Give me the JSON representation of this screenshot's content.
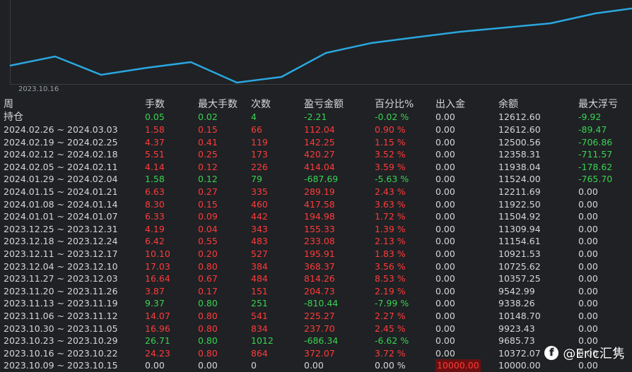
{
  "chart": {
    "date_label": "2023.10.16",
    "line_color": "#2aa7e0"
  },
  "headers": [
    "周",
    "手数",
    "最大手数",
    "次数",
    "盈亏金额",
    "百分比%",
    "出入金",
    "余额",
    "最大浮亏"
  ],
  "holding": {
    "label": "持仓",
    "lots": "0.05",
    "max_lots": "0.02",
    "count": "4",
    "pl": "-2.21",
    "pct": "-0.02 %",
    "io": "0.00",
    "balance": "12612.60",
    "max_float": "-9.92"
  },
  "rows": [
    {
      "period": "2024.02.26 ~ 2024.03.03",
      "lots": "1.58",
      "max_lots": "0.15",
      "count": "66",
      "pl": "112.04",
      "pct": "0.90 %",
      "io": "0.00",
      "balance": "12612.60",
      "max_float": "-89.47",
      "tone": "red",
      "float_tone": "green"
    },
    {
      "period": "2024.02.19 ~ 2024.02.25",
      "lots": "4.37",
      "max_lots": "0.41",
      "count": "119",
      "pl": "142.25",
      "pct": "1.15 %",
      "io": "0.00",
      "balance": "12500.56",
      "max_float": "-706.86",
      "tone": "red",
      "float_tone": "green"
    },
    {
      "period": "2024.02.12 ~ 2024.02.18",
      "lots": "5.51",
      "max_lots": "0.25",
      "count": "173",
      "pl": "420.27",
      "pct": "3.52 %",
      "io": "0.00",
      "balance": "12358.31",
      "max_float": "-711.57",
      "tone": "red",
      "float_tone": "green"
    },
    {
      "period": "2024.02.05 ~ 2024.02.11",
      "lots": "4.14",
      "max_lots": "0.12",
      "count": "226",
      "pl": "414.04",
      "pct": "3.59 %",
      "io": "0.00",
      "balance": "11938.04",
      "max_float": "-178.62",
      "tone": "red",
      "float_tone": "green"
    },
    {
      "period": "2024.01.29 ~ 2024.02.04",
      "lots": "1.58",
      "max_lots": "0.12",
      "count": "79",
      "pl": "-687.69",
      "pct": "-5.63 %",
      "io": "0.00",
      "balance": "11524.00",
      "max_float": "-765.70",
      "tone": "green",
      "float_tone": "green"
    },
    {
      "period": "2024.01.15 ~ 2024.01.21",
      "lots": "6.63",
      "max_lots": "0.27",
      "count": "335",
      "pl": "289.19",
      "pct": "2.43 %",
      "io": "0.00",
      "balance": "12211.69",
      "max_float": "0.00",
      "tone": "red",
      "float_tone": "neutral"
    },
    {
      "period": "2024.01.08 ~ 2024.01.14",
      "lots": "8.30",
      "max_lots": "0.15",
      "count": "460",
      "pl": "417.58",
      "pct": "3.63 %",
      "io": "0.00",
      "balance": "11922.50",
      "max_float": "0.00",
      "tone": "red",
      "float_tone": "neutral"
    },
    {
      "period": "2024.01.01 ~ 2024.01.07",
      "lots": "6.33",
      "max_lots": "0.09",
      "count": "442",
      "pl": "194.98",
      "pct": "1.72 %",
      "io": "0.00",
      "balance": "11504.92",
      "max_float": "0.00",
      "tone": "red",
      "float_tone": "neutral"
    },
    {
      "period": "2023.12.25 ~ 2023.12.31",
      "lots": "4.19",
      "max_lots": "0.04",
      "count": "343",
      "pl": "155.33",
      "pct": "1.39 %",
      "io": "0.00",
      "balance": "11309.94",
      "max_float": "0.00",
      "tone": "red",
      "float_tone": "neutral"
    },
    {
      "period": "2023.12.18 ~ 2023.12.24",
      "lots": "6.42",
      "max_lots": "0.55",
      "count": "483",
      "pl": "233.08",
      "pct": "2.13 %",
      "io": "0.00",
      "balance": "11154.61",
      "max_float": "0.00",
      "tone": "red",
      "float_tone": "neutral"
    },
    {
      "period": "2023.12.11 ~ 2023.12.17",
      "lots": "10.10",
      "max_lots": "0.20",
      "count": "527",
      "pl": "195.91",
      "pct": "1.83 %",
      "io": "0.00",
      "balance": "10921.53",
      "max_float": "0.00",
      "tone": "red",
      "float_tone": "neutral"
    },
    {
      "period": "2023.12.04 ~ 2023.12.10",
      "lots": "17.03",
      "max_lots": "0.80",
      "count": "384",
      "pl": "368.37",
      "pct": "3.56 %",
      "io": "0.00",
      "balance": "10725.62",
      "max_float": "0.00",
      "tone": "red",
      "float_tone": "neutral"
    },
    {
      "period": "2023.11.27 ~ 2023.12.03",
      "lots": "16.64",
      "max_lots": "0.67",
      "count": "484",
      "pl": "814.26",
      "pct": "8.53 %",
      "io": "0.00",
      "balance": "10357.25",
      "max_float": "0.00",
      "tone": "red",
      "float_tone": "neutral"
    },
    {
      "period": "2023.11.20 ~ 2023.11.26",
      "lots": "3.87",
      "max_lots": "0.17",
      "count": "151",
      "pl": "204.73",
      "pct": "2.19 %",
      "io": "0.00",
      "balance": "9542.99",
      "max_float": "0.00",
      "tone": "red",
      "float_tone": "neutral"
    },
    {
      "period": "2023.11.13 ~ 2023.11.19",
      "lots": "9.37",
      "max_lots": "0.80",
      "count": "251",
      "pl": "-810.44",
      "pct": "-7.99 %",
      "io": "0.00",
      "balance": "9338.26",
      "max_float": "0.00",
      "tone": "green",
      "float_tone": "neutral"
    },
    {
      "period": "2023.11.06 ~ 2023.11.12",
      "lots": "14.07",
      "max_lots": "0.80",
      "count": "541",
      "pl": "225.27",
      "pct": "2.27 %",
      "io": "0.00",
      "balance": "10148.70",
      "max_float": "0.00",
      "tone": "red",
      "float_tone": "neutral"
    },
    {
      "period": "2023.10.30 ~ 2023.11.05",
      "lots": "16.96",
      "max_lots": "0.80",
      "count": "834",
      "pl": "237.70",
      "pct": "2.45 %",
      "io": "0.00",
      "balance": "9923.43",
      "max_float": "0.00",
      "tone": "red",
      "float_tone": "neutral"
    },
    {
      "period": "2023.10.23 ~ 2023.10.29",
      "lots": "26.71",
      "max_lots": "0.80",
      "count": "1012",
      "pl": "-686.34",
      "pct": "-6.62 %",
      "io": "0.00",
      "balance": "9685.73",
      "max_float": "0.00",
      "tone": "green",
      "float_tone": "neutral"
    },
    {
      "period": "2023.10.16 ~ 2023.10.22",
      "lots": "24.23",
      "max_lots": "0.80",
      "count": "864",
      "pl": "372.07",
      "pct": "3.72 %",
      "io": "0.00",
      "balance": "10372.07",
      "max_float": "0.00",
      "tone": "red",
      "float_tone": "neutral"
    },
    {
      "period": "2023.10.09 ~ 2023.10.15",
      "lots": "0.00",
      "max_lots": "0.00",
      "count": "0",
      "pl": "0.00",
      "pct": "0.00 %",
      "io": "10000.00",
      "balance": "10000.00",
      "max_float": "0.00",
      "tone": "neutral",
      "float_tone": "neutral",
      "io_highlight": true
    }
  ],
  "watermark": {
    "icon": "facebook-icon",
    "text": "@Eric汇隽"
  }
}
